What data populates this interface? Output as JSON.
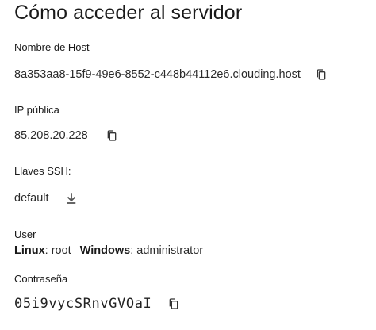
{
  "page": {
    "title": "Cómo acceder al servidor"
  },
  "host": {
    "label": "Nombre de Host",
    "value": "8a353aa8-15f9-49e6-8552-c448b44112e6.clouding.host",
    "copy_icon": "copy-icon"
  },
  "ip": {
    "label": "IP pública",
    "value": "85.208.20.228",
    "copy_icon": "copy-icon"
  },
  "ssh": {
    "label": "Llaves SSH:",
    "value": "default",
    "download_icon": "download-icon"
  },
  "user": {
    "label": "User",
    "linux_label": "Linux",
    "linux_value": ": root",
    "windows_label": "Windows",
    "windows_value": ": administrator"
  },
  "password": {
    "label": "Contraseña",
    "value": "05i9vycSRnvGVOaI",
    "copy_icon": "copy-icon"
  },
  "colors": {
    "text": "#1a1a1a",
    "icon": "#333333",
    "background": "#ffffff"
  }
}
